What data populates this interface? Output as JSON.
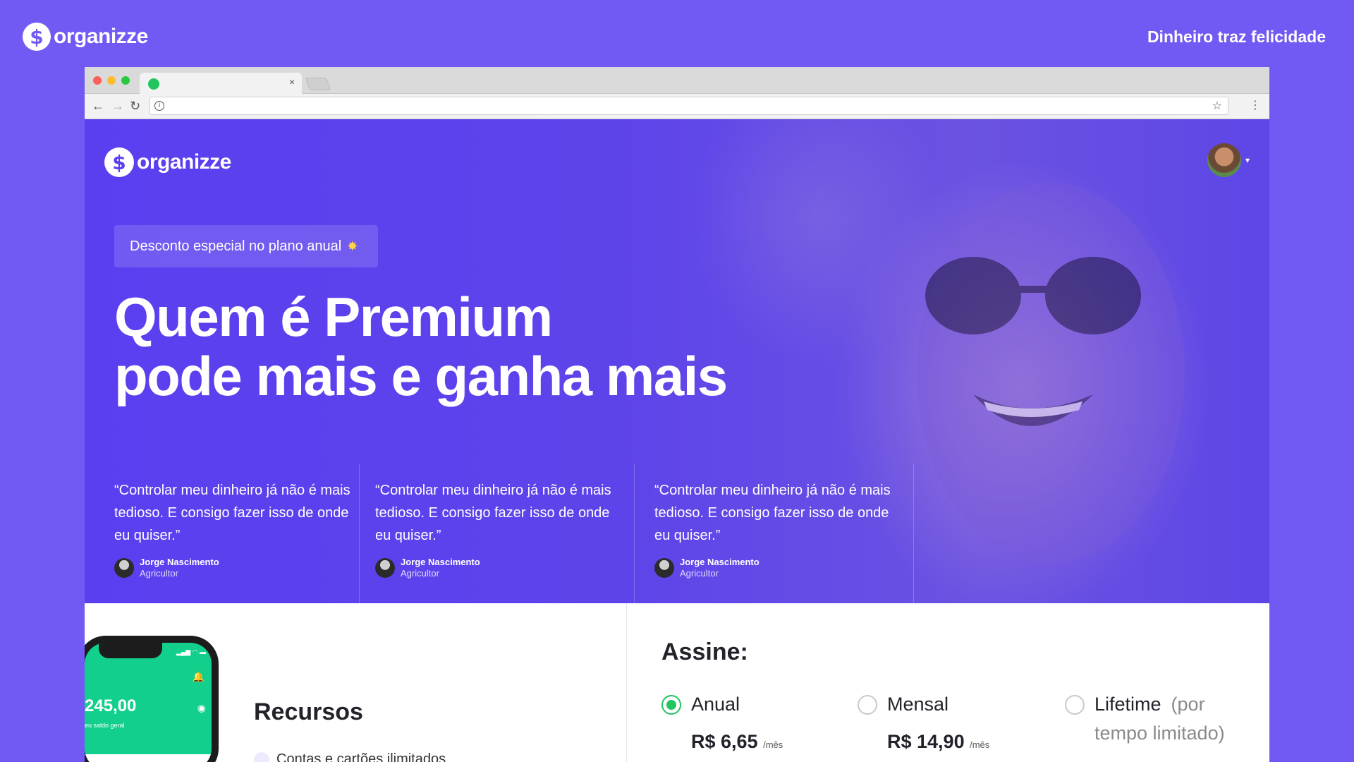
{
  "outer": {
    "logo_mark": "$",
    "logo_text": "organizze",
    "tagline": "Dinheiro traz felicidade"
  },
  "browser": {
    "tab_close": "×",
    "nav": {
      "back": "←",
      "forward": "→",
      "reload": "↻"
    },
    "omnibox": {
      "info": "i",
      "star": "☆",
      "menu": "⋮",
      "url": ""
    }
  },
  "hero": {
    "logo_mark": "$",
    "logo_text": "organizze",
    "badge": "Desconto especial no plano anual",
    "badge_spark": "✸",
    "headline_line1": "Quem é Premium",
    "headline_line2": "pode mais e ganha mais",
    "caret": "▾",
    "testimonials": [
      {
        "quote": "“Controlar meu dinheiro já não é mais tedioso. E consigo fazer isso de onde eu quiser.”",
        "name": "Jorge Nascimento",
        "role": "Agricultor"
      },
      {
        "quote": "“Controlar meu dinheiro já não é mais tedioso. E consigo fazer isso de onde eu quiser.”",
        "name": "Jorge Nascimento",
        "role": "Agricultor"
      },
      {
        "quote": "“Controlar meu dinheiro já não é mais tedioso. E consigo fazer isso de onde eu quiser.”",
        "name": "Jorge Nascimento",
        "role": "Agricultor"
      }
    ]
  },
  "phone": {
    "status": "▂▄▆ ◠ ▬",
    "bell": "🔔",
    "balance": "245,00",
    "eye": "◉",
    "balance_label": "eu saldo geral"
  },
  "recursos": {
    "title": "Recursos",
    "first_item": "Contas e cartões ilimitados"
  },
  "assine": {
    "title": "Assine:",
    "plans": [
      {
        "name": "Anual",
        "price": "R$ 6,65",
        "period": "/mês",
        "selected": true
      },
      {
        "name": "Mensal",
        "price": "R$ 14,90",
        "period": "/mês",
        "selected": false
      },
      {
        "name": "Lifetime",
        "note_line1": "(por",
        "note_line2": "tempo limitado)",
        "selected": false
      }
    ]
  },
  "colors": {
    "background": "#7159f3",
    "hero": "#5a3ff0",
    "accent_green": "#22c55e",
    "text_dark": "#22232a"
  }
}
